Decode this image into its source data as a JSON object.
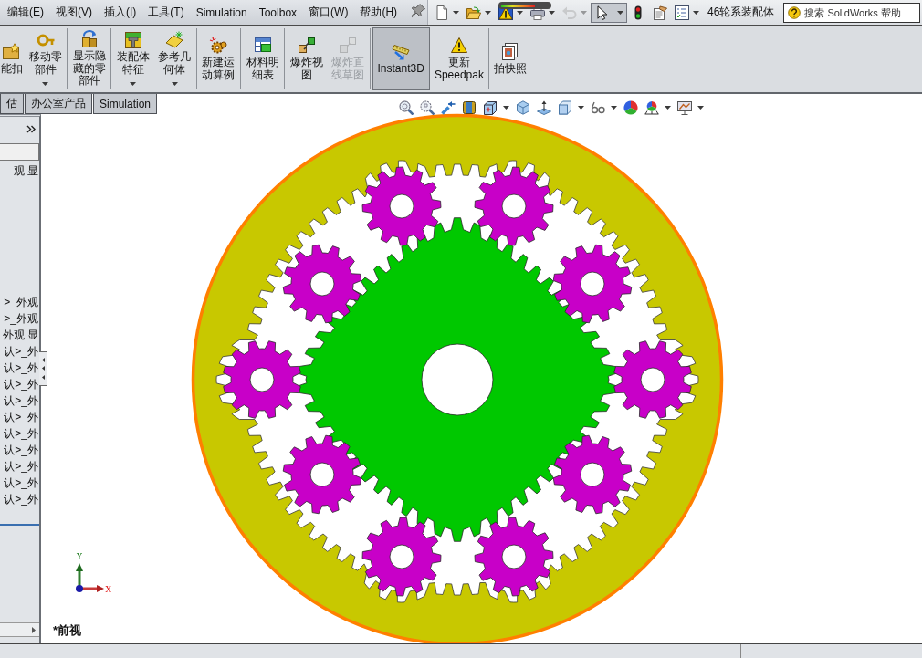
{
  "menu_bar": {
    "items": [
      "编辑(E)",
      "视图(V)",
      "插入(I)",
      "工具(T)",
      "Simulation",
      "Toolbox",
      "窗口(W)",
      "帮助(H)"
    ]
  },
  "quick_access": {
    "tools": [
      {
        "dropdown": true,
        "disabled": false,
        "selected": false
      },
      {
        "dropdown": true,
        "disabled": false,
        "selected": false
      },
      {
        "dropdown": true,
        "disabled": false,
        "selected": false
      },
      {
        "dropdown": true,
        "disabled": false,
        "selected": false
      },
      {
        "dropdown": true,
        "disabled": true,
        "selected": false
      },
      {
        "dropdown": true,
        "disabled": false,
        "selected": true
      },
      {
        "dropdown": false,
        "disabled": false,
        "selected": false
      },
      {
        "dropdown": false,
        "disabled": false,
        "selected": false
      },
      {
        "dropdown": true,
        "disabled": false,
        "selected": false
      }
    ],
    "rebuild_meter": {
      "level": 0.72
    }
  },
  "window": {
    "title": "46轮系装配体"
  },
  "help_search": {
    "placeholder": "搜索 SolidWorks 帮助"
  },
  "command_manager": {
    "groups": [
      [
        {
          "label": "能扣",
          "dropdown": false,
          "disabled": false,
          "selected": false
        },
        {
          "label": "移动零部件",
          "dropdown": true,
          "disabled": false,
          "selected": false
        }
      ],
      [
        {
          "label": "显示隐藏的零部件",
          "dropdown": false,
          "disabled": false,
          "selected": false
        }
      ],
      [
        {
          "label": "装配体特征",
          "dropdown": true,
          "disabled": false,
          "selected": false
        },
        {
          "label": "参考几何体",
          "dropdown": true,
          "disabled": false,
          "selected": false
        }
      ],
      [
        {
          "label": "新建运动算例",
          "dropdown": false,
          "disabled": false,
          "selected": false
        }
      ],
      [
        {
          "label": "材料明细表",
          "dropdown": false,
          "disabled": false,
          "selected": false
        }
      ],
      [
        {
          "label": "爆炸视图",
          "dropdown": false,
          "disabled": false,
          "selected": false
        },
        {
          "label": "爆炸直线草图",
          "dropdown": false,
          "disabled": true,
          "selected": false
        }
      ],
      [
        {
          "label": "Instant3D",
          "dropdown": false,
          "disabled": false,
          "selected": true
        },
        {
          "label": "更新 Speedpak",
          "dropdown": false,
          "disabled": false,
          "selected": false
        }
      ],
      [
        {
          "label": "拍快照",
          "dropdown": false,
          "disabled": false,
          "selected": false
        }
      ]
    ]
  },
  "tabs": [
    {
      "label": "估",
      "selected": false
    },
    {
      "label": "办公室产品",
      "selected": false
    },
    {
      "label": "Simulation",
      "selected": false
    }
  ],
  "feature_tree": {
    "top_rows": [
      "观 显"
    ],
    "rows": [
      ">_外观",
      ">_外观",
      "外观 显",
      "认>_外",
      "认>_外",
      "认>_外",
      "认>_外",
      "认>_外",
      "认>_外",
      "认>_外",
      "认>_外",
      "认>_外",
      "认>_外"
    ]
  },
  "viewport": {
    "view_name": "*前视",
    "triad": {
      "y_label": "Y",
      "x_label": "X"
    }
  }
}
